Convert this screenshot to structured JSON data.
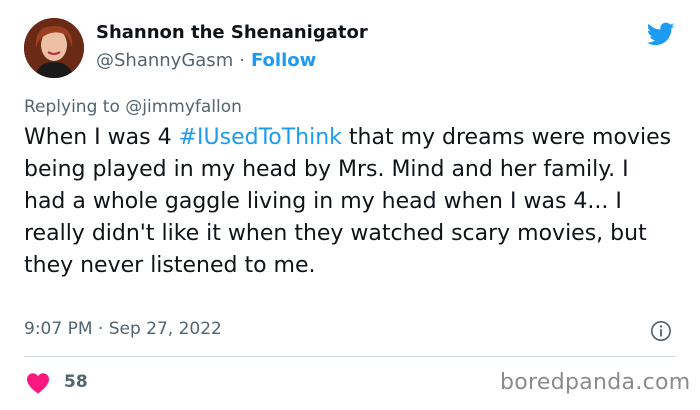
{
  "author": {
    "display_name": "Shannon the Shenanigator",
    "handle": "@ShannyGasm",
    "separator": "·",
    "follow_label": "Follow"
  },
  "reply": {
    "prefix": "Replying to",
    "mention": "@jimmyfallon"
  },
  "tweet": {
    "text_before": "When I was 4 ",
    "hashtag": "#IUsedToThink",
    "text_after": " that my dreams were movies being played in my head by Mrs. Mind and her family. I had a whole gaggle living in my head when I was 4... I really didn't like it when they watched scary movies, but they never listened to me.",
    "time": "9:07 PM",
    "separator": "·",
    "date": "Sep 27, 2022"
  },
  "engagement": {
    "likes": "58"
  },
  "watermark": "boredpanda.com",
  "icons": {
    "brand": "twitter-bird-icon",
    "info": "info-icon",
    "like": "heart-icon"
  },
  "colors": {
    "accent": "#1d9bf0",
    "heart": "#f91880",
    "muted": "#536471",
    "text": "#0f1419"
  }
}
